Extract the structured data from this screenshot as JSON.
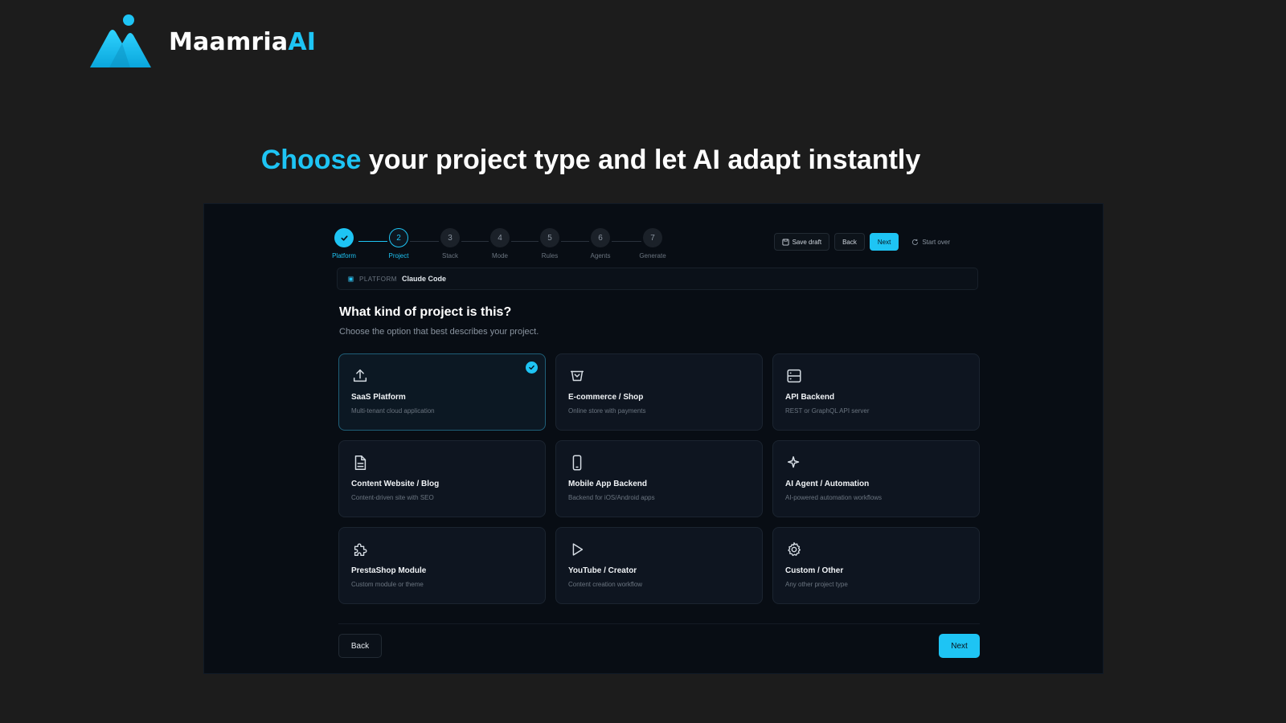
{
  "brand": {
    "name_part1": "Maamria",
    "name_part2": "AI",
    "color": "#1ec4f4"
  },
  "headline": {
    "accent": "Choose",
    "rest": " your project type and let AI adapt instantly"
  },
  "stepper": {
    "steps": [
      {
        "number": "1",
        "label": "Platform",
        "state": "done"
      },
      {
        "number": "2",
        "label": "Project",
        "state": "current"
      },
      {
        "number": "3",
        "label": "Stack",
        "state": "pending"
      },
      {
        "number": "4",
        "label": "Mode",
        "state": "pending"
      },
      {
        "number": "5",
        "label": "Rules",
        "state": "pending"
      },
      {
        "number": "6",
        "label": "Agents",
        "state": "pending"
      },
      {
        "number": "7",
        "label": "Generate",
        "state": "pending"
      }
    ]
  },
  "toolbar": {
    "save_draft": "Save draft",
    "back": "Back",
    "next": "Next",
    "start_over": "Start over"
  },
  "platform": {
    "label": "PLATFORM",
    "value": "Claude Code"
  },
  "question": {
    "title": "What kind of project is this?",
    "subtitle": "Choose the option that best describes your project."
  },
  "options": [
    {
      "title": "SaaS Platform",
      "desc": "Multi-tenant cloud application",
      "icon": "upload-icon",
      "selected": true
    },
    {
      "title": "E-commerce / Shop",
      "desc": "Online store with payments",
      "icon": "basket-icon",
      "selected": false
    },
    {
      "title": "API Backend",
      "desc": "REST or GraphQL API server",
      "icon": "server-icon",
      "selected": false
    },
    {
      "title": "Content Website / Blog",
      "desc": "Content-driven site with SEO",
      "icon": "document-icon",
      "selected": false
    },
    {
      "title": "Mobile App Backend",
      "desc": "Backend for iOS/Android apps",
      "icon": "smartphone-icon",
      "selected": false
    },
    {
      "title": "AI Agent / Automation",
      "desc": "AI-powered automation workflows",
      "icon": "sparkle-icon",
      "selected": false
    },
    {
      "title": "PrestaShop Module",
      "desc": "Custom module or theme",
      "icon": "puzzle-icon",
      "selected": false
    },
    {
      "title": "YouTube / Creator",
      "desc": "Content creation workflow",
      "icon": "play-icon",
      "selected": false
    },
    {
      "title": "Custom / Other",
      "desc": "Any other project type",
      "icon": "gear-icon",
      "selected": false
    }
  ],
  "footer": {
    "back": "Back",
    "next": "Next"
  }
}
